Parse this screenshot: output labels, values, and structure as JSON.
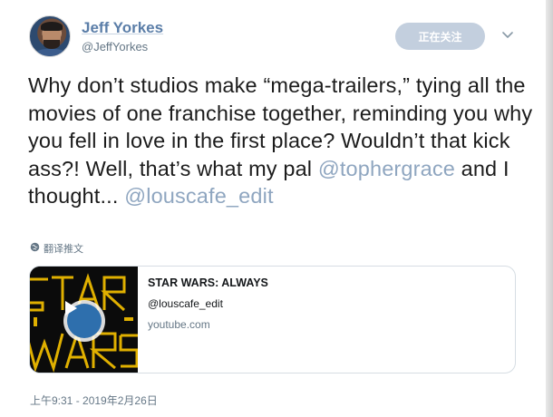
{
  "author": {
    "display_name": "Jeff Yorkes",
    "handle": "@JeffYorkes"
  },
  "follow_button": {
    "label": "正在关注"
  },
  "tweet": {
    "segments": [
      {
        "text": "Why don’t studios make “mega-trailers,” tying all the movies of one franchise together, reminding you why you fell in love in the first place? Wouldn’t that kick ass?! Well, that’s what my pal ",
        "mention": false
      },
      {
        "text": "@tophergrace",
        "mention": true
      },
      {
        "text": " and I thought... ",
        "mention": false
      },
      {
        "text": "@louscafe_edit",
        "mention": true
      }
    ]
  },
  "translate": {
    "label": "翻译推文",
    "icon": "globe-icon"
  },
  "card": {
    "title": "STAR WARS: ALWAYS",
    "description": "@louscafe_edit",
    "domain": "youtube.com",
    "thumbnail_icon": "play-icon"
  },
  "timestamp": "上午9:31 - 2019年2月26日",
  "colors": {
    "name": "#5b7ea8",
    "mention": "#8fa6c0",
    "follow_bg": "#c3cfde",
    "secondary_text": "#657786",
    "play": "#2e6fad"
  }
}
